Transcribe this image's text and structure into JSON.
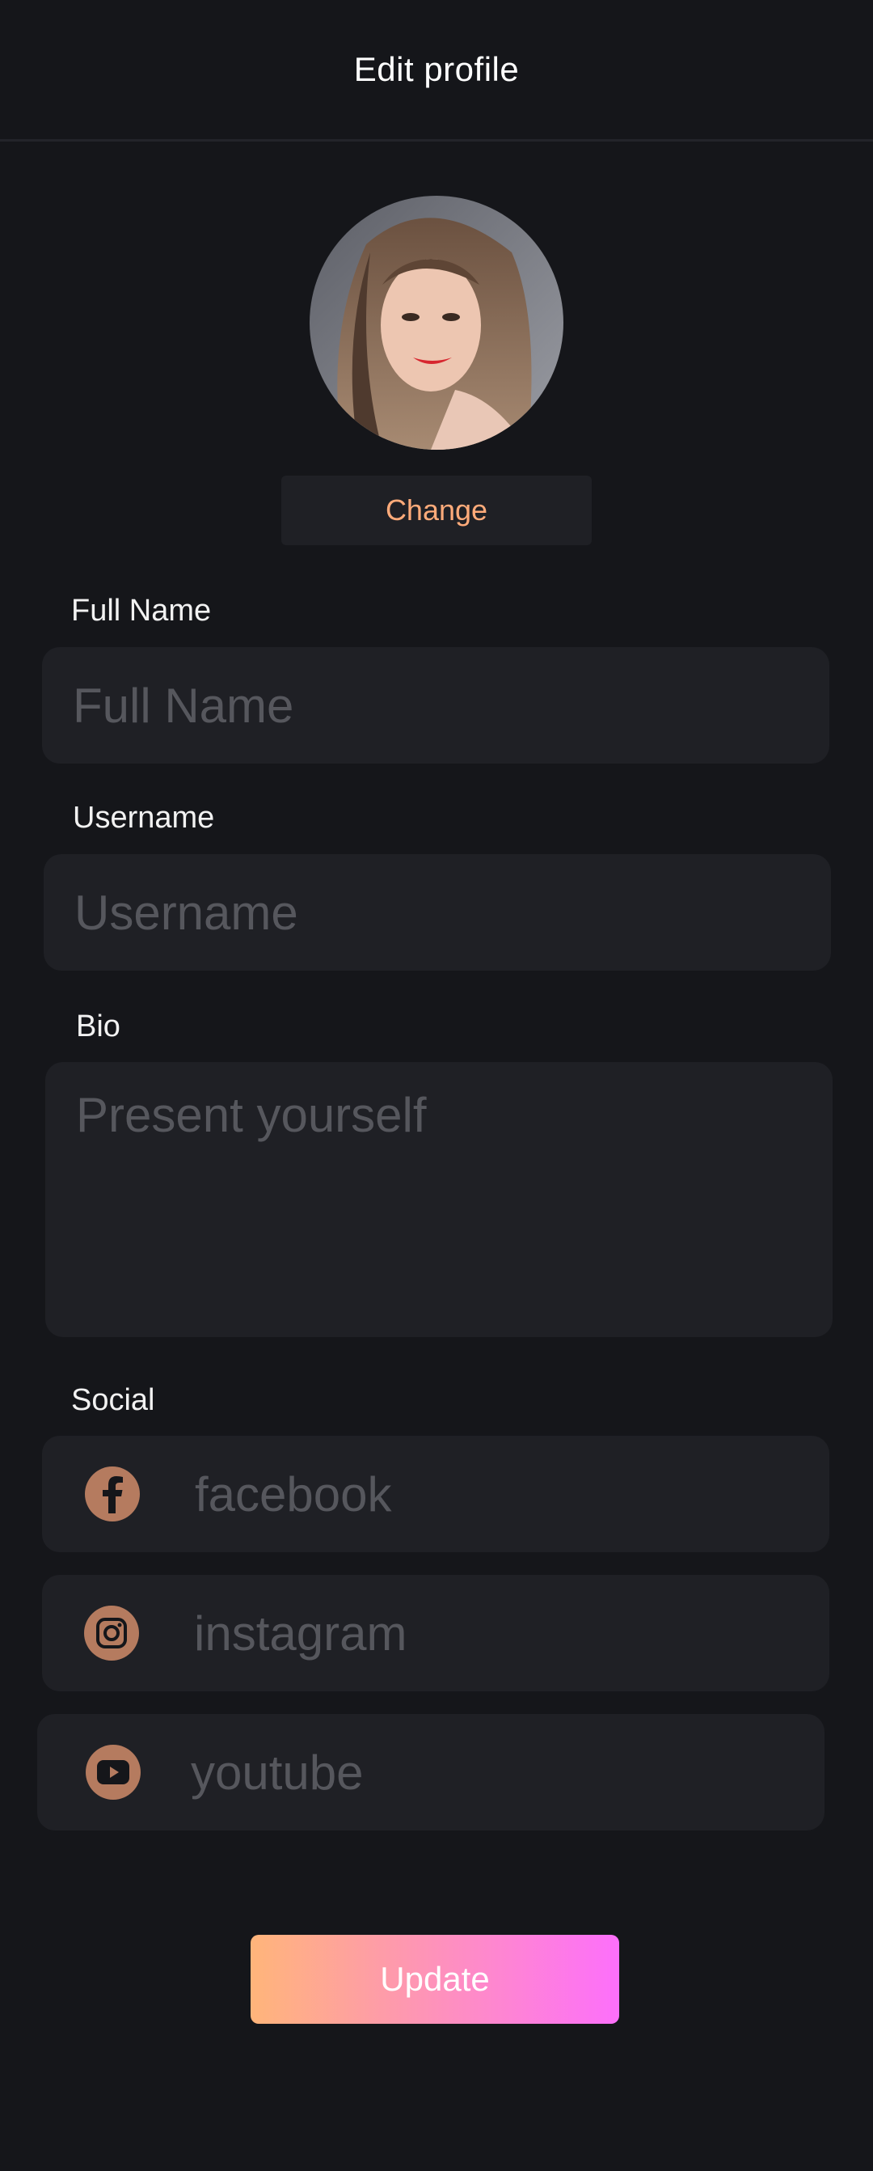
{
  "header": {
    "title": "Edit profile"
  },
  "profile": {
    "change_label": "Change"
  },
  "fields": {
    "full_name": {
      "label": "Full Name",
      "placeholder": "Full Name",
      "value": ""
    },
    "username": {
      "label": "Username",
      "placeholder": "Username",
      "value": ""
    },
    "bio": {
      "label": "Bio",
      "placeholder": "Present yourself",
      "value": ""
    }
  },
  "social": {
    "label": "Social",
    "items": [
      {
        "icon": "facebook-icon",
        "placeholder": "facebook",
        "value": ""
      },
      {
        "icon": "instagram-icon",
        "placeholder": "instagram",
        "value": ""
      },
      {
        "icon": "youtube-icon",
        "placeholder": "youtube",
        "value": ""
      }
    ]
  },
  "actions": {
    "update_label": "Update"
  },
  "colors": {
    "background": "#15161a",
    "field_background": "#1f2025",
    "accent": "#ffab7a",
    "icon_color": "#b57b5f",
    "gradient_start": "#ffb57a",
    "gradient_end": "#fd6ffb"
  }
}
